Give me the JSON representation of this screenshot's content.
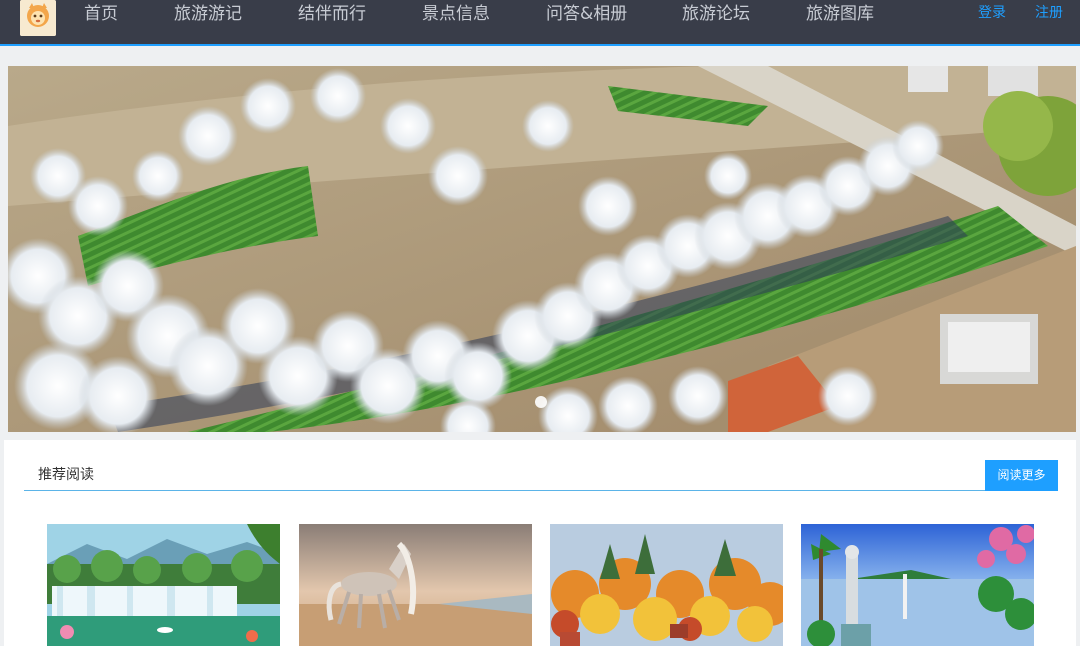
{
  "nav": {
    "items": [
      "首页",
      "旅游游记",
      "结伴而行",
      "景点信息",
      "问答&相册",
      "旅游论坛",
      "旅游图库"
    ],
    "login": "登录",
    "register": "注册"
  },
  "banner": {
    "slide_count": 1,
    "active_slide": 1
  },
  "recommend": {
    "title": "推荐阅读",
    "more_button": "阅读更多",
    "cards": [
      "waterfall-painting",
      "white-horse-painting",
      "autumn-forest-painting",
      "seaside-statue-painting"
    ]
  },
  "colors": {
    "nav_bg": "#393d49",
    "accent": "#1e9fff",
    "nav_text": "#c8ccd4"
  }
}
